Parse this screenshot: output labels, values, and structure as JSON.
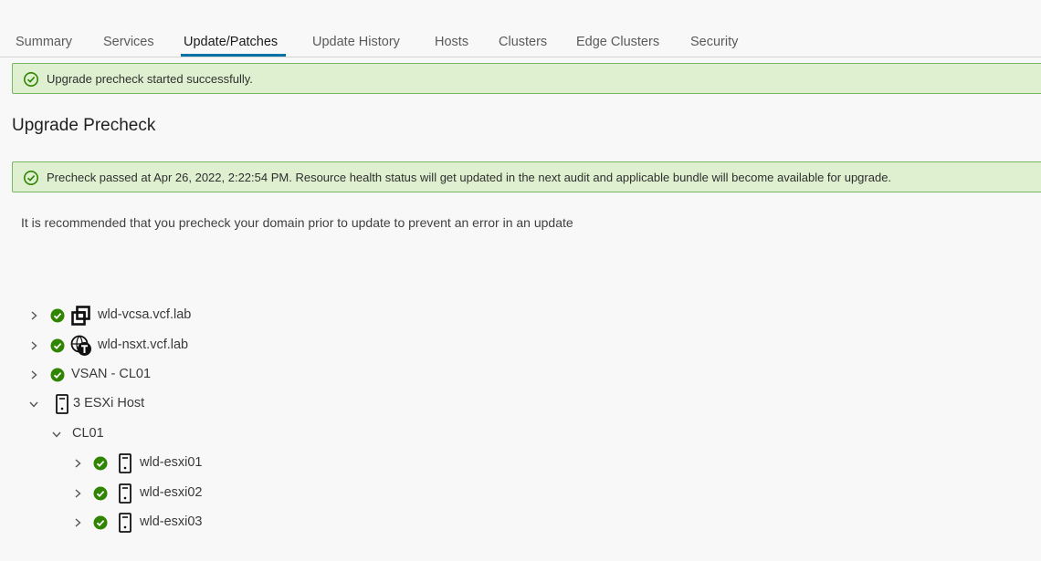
{
  "tabs": [
    {
      "label": "Summary"
    },
    {
      "label": "Services"
    },
    {
      "label": "Update/Patches"
    },
    {
      "label": "Update History"
    },
    {
      "label": "Hosts"
    },
    {
      "label": "Clusters"
    },
    {
      "label": "Edge Clusters"
    },
    {
      "label": "Security"
    }
  ],
  "active_tab": "Update/Patches",
  "alerts": {
    "started": "Upgrade precheck started successfully.",
    "passed": "Precheck passed at Apr 26, 2022, 2:22:54 PM. Resource health status will get updated in the next audit and applicable bundle will become available for upgrade."
  },
  "page_title": "Upgrade Precheck",
  "recommendation": "It is recommended that you precheck your domain prior to update to prevent an error in an update",
  "tree": {
    "vcenter": {
      "label": "wld-vcsa.vcf.lab",
      "icon": "vcenter-icon",
      "status": "success"
    },
    "nsxt": {
      "label": "wld-nsxt.vcf.lab",
      "icon": "nsx-t-icon",
      "status": "success"
    },
    "vsan": {
      "label": "VSAN - CL01",
      "status": "success"
    },
    "esxi_group": {
      "label": "3 ESXi Host",
      "icon": "host-icon",
      "expanded": true
    },
    "cluster": {
      "label": "CL01",
      "expanded": true
    },
    "hosts": [
      {
        "label": "wld-esxi01",
        "status": "success",
        "icon": "host-icon"
      },
      {
        "label": "wld-esxi02",
        "status": "success",
        "icon": "host-icon"
      },
      {
        "label": "wld-esxi03",
        "status": "success",
        "icon": "host-icon"
      }
    ]
  },
  "colors": {
    "accent": "#0072a3",
    "success": "#2f8400",
    "alert_bg": "#dff0d0",
    "alert_border": "#7bb661"
  }
}
